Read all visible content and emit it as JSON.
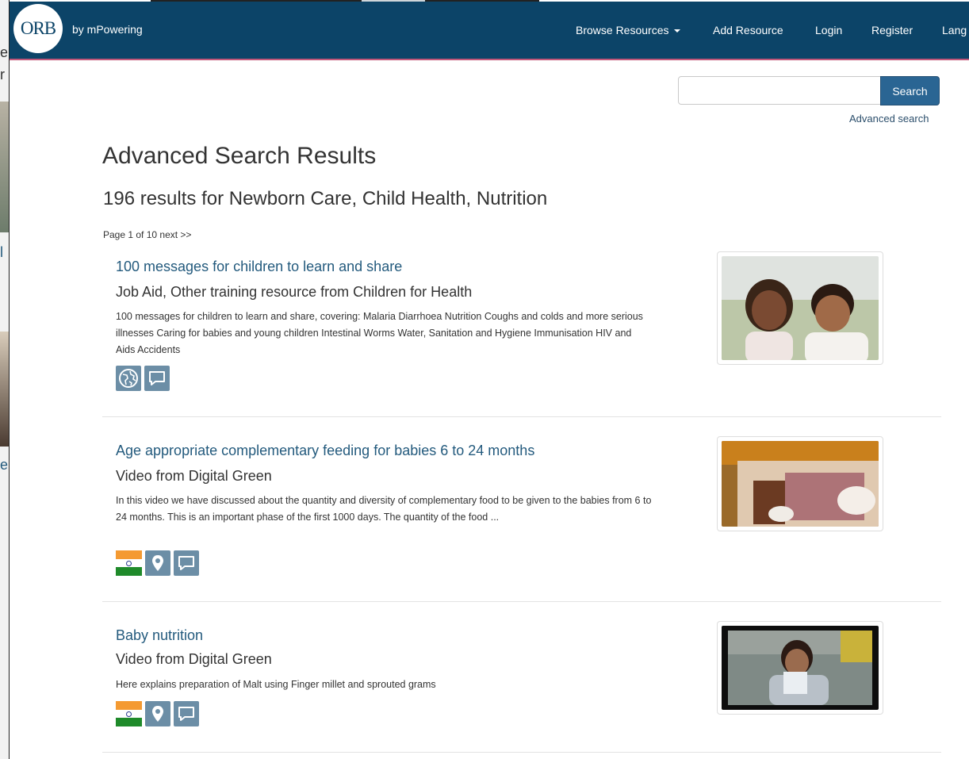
{
  "nav": {
    "brand_logo": "ORB",
    "brand_sub": "by mPowering",
    "items": [
      {
        "label": "Browse Resources",
        "has_caret": true
      },
      {
        "label": "Add Resource"
      },
      {
        "label": "Login"
      },
      {
        "label": "Register"
      },
      {
        "label": "Lang"
      }
    ]
  },
  "search": {
    "value": "",
    "button_label": "Search",
    "advanced_link": "Advanced search"
  },
  "page": {
    "title": "Advanced Search Results",
    "count_line": "196 results for Newborn Care, Child Health, Nutrition",
    "pager_text": "Page 1 of 10",
    "pager_next": "next >>"
  },
  "results": [
    {
      "title": "100 messages for children to learn and share",
      "subtitle": "Job Aid, Other training resource from Children for Health",
      "description": "100 messages for children to learn and share, covering: Malaria Diarrhoea Nutrition Coughs and colds and more serious illnesses Caring for babies and young children Intestinal Worms Water, Sanitation and Hygiene Immunisation HIV and Aids Accidents",
      "icons": [
        "globe-icon",
        "speech-bubble-icon"
      ]
    },
    {
      "title": "Age appropriate complementary feeding for babies 6 to 24 months",
      "subtitle": "Video from Digital Green",
      "description": "In this video we have discussed about the quantity and diversity of complementary food to be given to the babies from 6 to 24 months. This is an important phase of the first 1000 days. The quantity of the food ...",
      "icons": [
        "india-flag-icon",
        "map-pin-icon",
        "speech-bubble-icon"
      ]
    },
    {
      "title": "Baby nutrition",
      "subtitle": "Video from Digital Green",
      "description": "Here explains preparation of Malt using Finger millet and sprouted grams",
      "icons": [
        "india-flag-icon",
        "map-pin-icon",
        "speech-bubble-icon"
      ]
    }
  ],
  "background_fragments": [
    "e",
    "r",
    "l",
    "e"
  ],
  "colors": {
    "navbar": "#0c4468",
    "navbar_accent": "#c2577a",
    "link": "#235a7d",
    "button": "#2a6593",
    "icon_bg": "#6c8ea6"
  }
}
